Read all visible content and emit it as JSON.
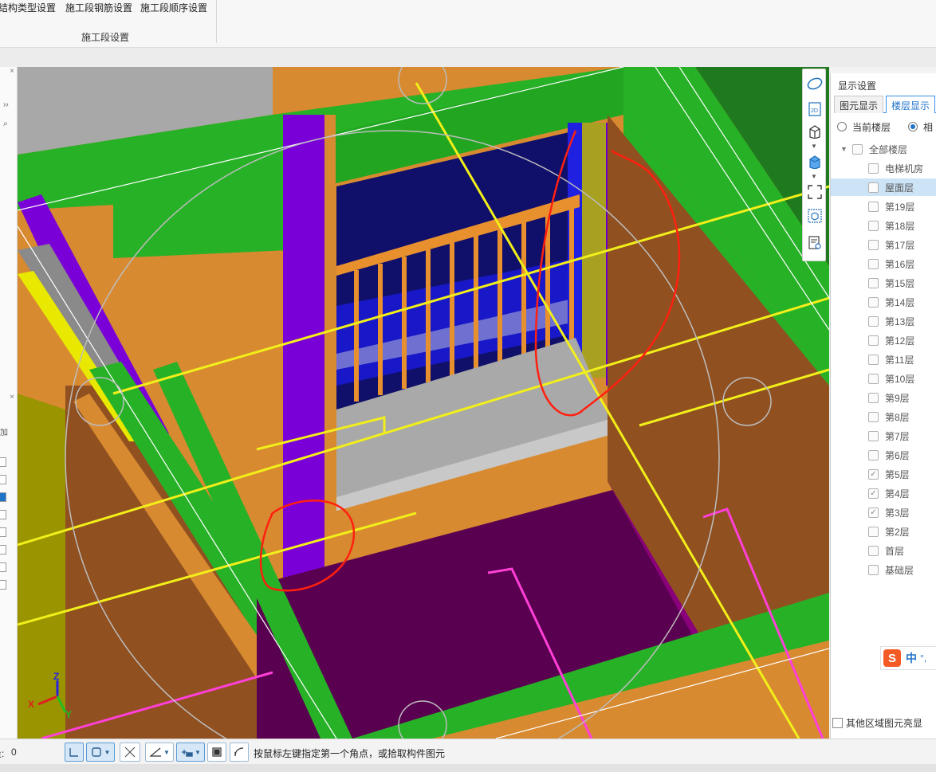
{
  "ribbon": {
    "buttons": [
      "结构类型设置",
      "施工段钢筋设置",
      "施工段顺序设置"
    ],
    "group_label": "施工段设置"
  },
  "left_rail": {
    "close_glyph": "×",
    "expand_glyph": "››",
    "search_glyph": "⌕",
    "add_label": "加"
  },
  "toolbar": {
    "icons": [
      "orbit-icon",
      "2d-view-icon",
      "3d-box-icon",
      "3d-box-blue-icon",
      "fit-view-icon",
      "iso-view-icon",
      "layer-eye-icon"
    ],
    "twod_label": "2D"
  },
  "display_panel": {
    "title": "显示设置",
    "tabs": [
      "图元显示",
      "楼层显示"
    ],
    "active_tab": 1,
    "radios": [
      {
        "label": "当前楼层",
        "selected": false
      },
      {
        "label": "相",
        "selected": true
      }
    ],
    "tree_root": "全部楼层",
    "floors": [
      {
        "label": "电梯机房",
        "checked": false,
        "selected": false
      },
      {
        "label": "屋面层",
        "checked": false,
        "selected": true
      },
      {
        "label": "第19层",
        "checked": false,
        "selected": false
      },
      {
        "label": "第18层",
        "checked": false,
        "selected": false
      },
      {
        "label": "第17层",
        "checked": false,
        "selected": false
      },
      {
        "label": "第16层",
        "checked": false,
        "selected": false
      },
      {
        "label": "第15层",
        "checked": false,
        "selected": false
      },
      {
        "label": "第14层",
        "checked": false,
        "selected": false
      },
      {
        "label": "第13层",
        "checked": false,
        "selected": false
      },
      {
        "label": "第12层",
        "checked": false,
        "selected": false
      },
      {
        "label": "第11层",
        "checked": false,
        "selected": false
      },
      {
        "label": "第10层",
        "checked": false,
        "selected": false
      },
      {
        "label": "第9层",
        "checked": false,
        "selected": false
      },
      {
        "label": "第8层",
        "checked": false,
        "selected": false
      },
      {
        "label": "第7层",
        "checked": false,
        "selected": false
      },
      {
        "label": "第6层",
        "checked": false,
        "selected": false
      },
      {
        "label": "第5层",
        "checked": true,
        "selected": false
      },
      {
        "label": "第4层",
        "checked": true,
        "selected": false
      },
      {
        "label": "第3层",
        "checked": true,
        "selected": false
      },
      {
        "label": "第2层",
        "checked": false,
        "selected": false
      },
      {
        "label": "首层",
        "checked": false,
        "selected": false
      },
      {
        "label": "基础层",
        "checked": false,
        "selected": false
      }
    ],
    "other_area_highlight": "其他区域图元亮显"
  },
  "ime": {
    "logo": "S",
    "mode": "中",
    "punct": "°,"
  },
  "axis": {
    "x": "X",
    "y": "Y",
    "z": "Z"
  },
  "status_bar": {
    "label": "量:",
    "value": "0",
    "hint": "按鼠标左键指定第一个角点，或拾取构件图元"
  },
  "colors": {
    "beam_orange": "#d88a30",
    "slab_green": "#27b127",
    "column_purple": "#7a00d8",
    "floor_maroon": "#5a0050",
    "axis_yellow": "#f2ef1a",
    "magenta_axis": "#ff40d8",
    "annotation_red": "#ff2010",
    "accent_blue": "#1f73c9"
  }
}
